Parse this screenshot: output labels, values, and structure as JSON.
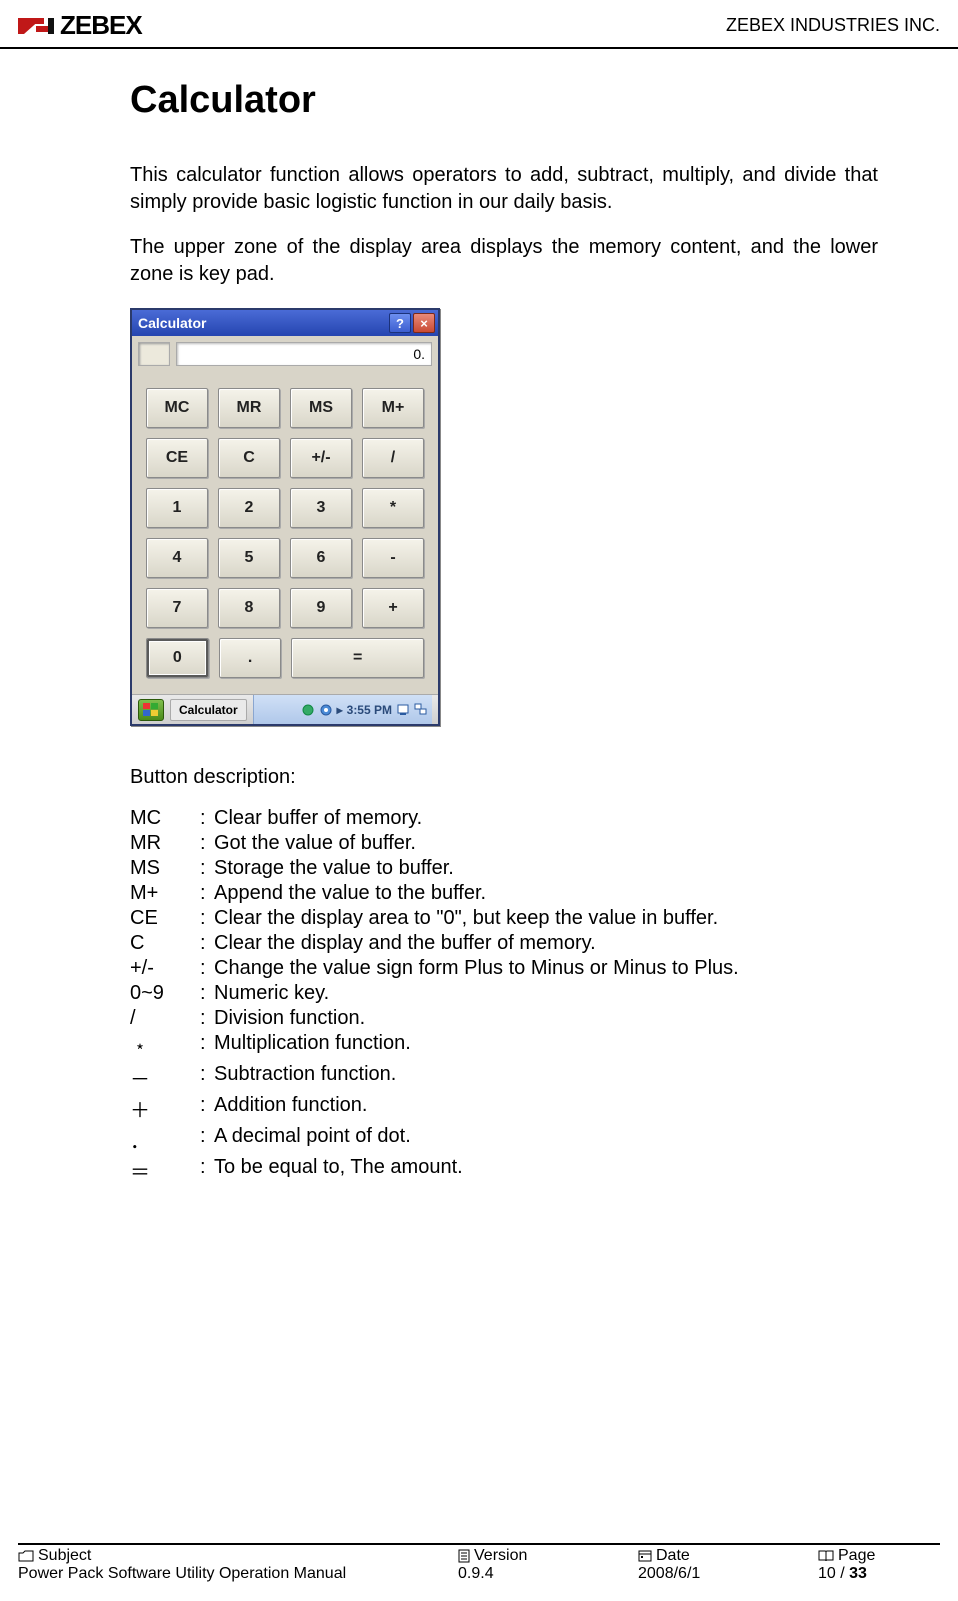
{
  "header": {
    "logo_text": "ZEBEX",
    "company": "ZEBEX INDUSTRIES INC."
  },
  "content": {
    "title": "Calculator",
    "para1": "This calculator function allows operators to add, subtract, multiply, and divide that simply provide basic logistic function in our daily basis.",
    "para2": "The upper zone of the display area displays the memory content, and the lower zone is key pad."
  },
  "calc": {
    "titlebar": "Calculator",
    "help": "?",
    "close": "×",
    "display": "0.",
    "keys": {
      "r1": [
        "MC",
        "MR",
        "MS",
        "M+"
      ],
      "r2": [
        "CE",
        "C",
        "+/-",
        "/"
      ],
      "r3": [
        "1",
        "2",
        "3",
        "*"
      ],
      "r4": [
        "4",
        "5",
        "6",
        "-"
      ],
      "r5": [
        "7",
        "8",
        "9",
        "+"
      ],
      "r6": [
        "0",
        ".",
        "="
      ]
    },
    "taskbar": {
      "app": "Calculator",
      "time": "3:55 PM",
      "sep": "▸"
    }
  },
  "desc": {
    "heading": "Button description:",
    "items": [
      {
        "k": "MC",
        "t": "Clear buffer of memory."
      },
      {
        "k": "MR",
        "t": "Got the value of buffer."
      },
      {
        "k": "MS",
        "t": "Storage the value to buffer."
      },
      {
        "k": "M+",
        "t": "Append the value to the buffer."
      },
      {
        "k": "CE",
        "t": "Clear the display area to \"0\", but keep the value in buffer."
      },
      {
        "k": "C",
        "t": "Clear the display and the buffer of memory."
      },
      {
        "k": "+/-",
        "t": "Change the value sign form Plus to Minus or Minus to Plus."
      },
      {
        "k": "0~9",
        "t": "Numeric key."
      },
      {
        "k": " /",
        "t": "Division function."
      },
      {
        "k": "﹡",
        "t": "Multiplication function."
      },
      {
        "k": "－",
        "t": "Subtraction function."
      },
      {
        "k": "＋",
        "t": "Addition function."
      },
      {
        "k": "．",
        "t": "A decimal point of dot."
      },
      {
        "k": "＝",
        "t": "To be equal to, The amount."
      }
    ]
  },
  "footer": {
    "subject_label": "Subject",
    "subject_value": "Power Pack Software Utility Operation Manual",
    "version_label": "Version",
    "version_value": "0.9.4",
    "date_label": "Date",
    "date_value": "2008/6/1",
    "page_label": "Page",
    "page_current": "10",
    "page_sep": " / ",
    "page_total": "33"
  }
}
